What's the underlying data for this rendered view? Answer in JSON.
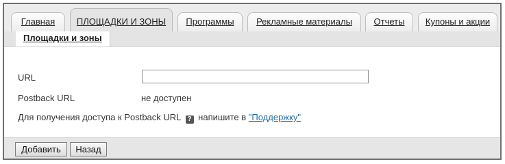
{
  "tabs": [
    {
      "label": "Главная",
      "active": false
    },
    {
      "label": "ПЛОЩАДКИ И ЗОНЫ",
      "active": true
    },
    {
      "label": "Программы",
      "active": false
    },
    {
      "label": "Рекламные материалы",
      "active": false
    },
    {
      "label": "Отчеты",
      "active": false
    },
    {
      "label": "Купоны и акции",
      "active": false
    }
  ],
  "subtab": {
    "label": "Площадки и зоны"
  },
  "form": {
    "url_label": "URL",
    "url_value": "",
    "postback_label": "Postback URL",
    "postback_value": "не доступен",
    "note_prefix": "Для получения доступа к Postback URL",
    "help_glyph": "?",
    "note_middle": "напишите в",
    "support_link": "\"Поддержку\""
  },
  "buttons": {
    "add": "Добавить",
    "back": "Назад"
  }
}
